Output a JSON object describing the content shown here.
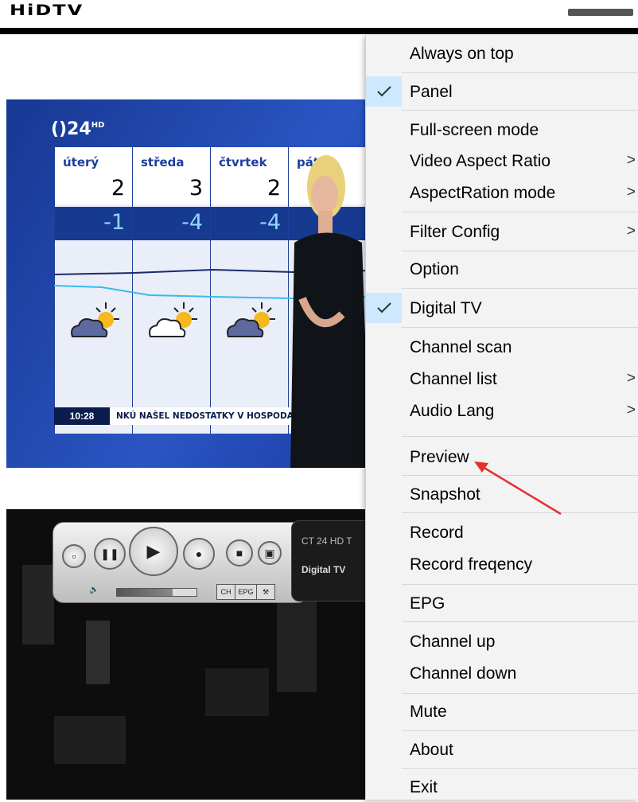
{
  "app": {
    "title": "HiDTV"
  },
  "video": {
    "channel_logo": "()24",
    "channel_logo_sup": "HD",
    "weather": {
      "days": [
        {
          "name": "úterý",
          "high": "2",
          "low": "-1"
        },
        {
          "name": "středa",
          "high": "3",
          "low": "-4"
        },
        {
          "name": "čtvrtek",
          "high": "2",
          "low": "-4"
        },
        {
          "name": "páte",
          "high": "",
          "low": ""
        }
      ]
    },
    "ticker": {
      "time": "10:28",
      "text": "NKÚ NAŠEL NEDOSTATKY V HOSPODAŘENÍ N"
    }
  },
  "player_panel": {
    "lcd_channel": "CT 24 HD T",
    "lcd_source": "Digital TV",
    "tabs": [
      "CH",
      "EPG",
      "⚒"
    ]
  },
  "context_menu": {
    "items": [
      {
        "label": "Always on top",
        "checked": false,
        "submenu": false
      },
      {
        "label": "Panel",
        "checked": true,
        "submenu": false
      },
      {
        "label": "Full-screen mode",
        "checked": false,
        "submenu": false
      },
      {
        "label": "Video Aspect Ratio",
        "checked": false,
        "submenu": true
      },
      {
        "label": "AspectRation mode",
        "checked": false,
        "submenu": true
      },
      {
        "label": "Filter Config",
        "checked": false,
        "submenu": true
      },
      {
        "label": "Option",
        "checked": false,
        "submenu": false
      },
      {
        "label": "Digital TV",
        "checked": true,
        "submenu": false
      },
      {
        "label": "Channel scan",
        "checked": false,
        "submenu": false
      },
      {
        "label": "Channel list",
        "checked": false,
        "submenu": true
      },
      {
        "label": "Audio Lang",
        "checked": false,
        "submenu": true
      },
      {
        "label": "Preview",
        "checked": false,
        "submenu": false
      },
      {
        "label": "Snapshot",
        "checked": false,
        "submenu": false
      },
      {
        "label": "Record",
        "checked": false,
        "submenu": false
      },
      {
        "label": "Record freqency",
        "checked": false,
        "submenu": false
      },
      {
        "label": "EPG",
        "checked": false,
        "submenu": false
      },
      {
        "label": "Channel up",
        "checked": false,
        "submenu": false
      },
      {
        "label": "Channel down",
        "checked": false,
        "submenu": false
      },
      {
        "label": "Mute",
        "checked": false,
        "submenu": false
      },
      {
        "label": "About",
        "checked": false,
        "submenu": false
      },
      {
        "label": "Exit",
        "checked": false,
        "submenu": false
      }
    ],
    "submenu_glyph": ">",
    "accent_color": "#cde8ff"
  },
  "annotation": {
    "arrow_color": "#e53030",
    "points_to": "Preview"
  }
}
